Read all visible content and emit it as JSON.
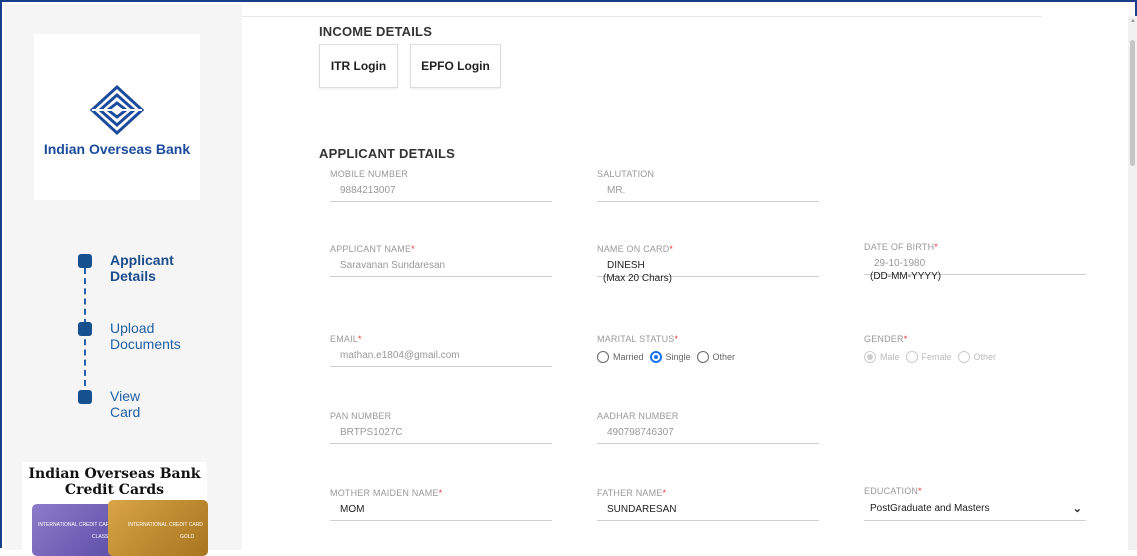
{
  "brand": {
    "name": "Indian Overseas Bank",
    "color": "#1c4a9c"
  },
  "steps": [
    {
      "label": "Applicant Details",
      "active": true
    },
    {
      "label": "Upload Documents",
      "active": false
    },
    {
      "label": "View Card",
      "active": false
    }
  ],
  "promo": {
    "title_line1": "Indian Overseas Bank",
    "title_line2": "Credit Cards",
    "card1_text": "INTERNATIONAL CREDIT CARD",
    "card2_text": "INTERNATIONAL CREDIT CARD",
    "card1_tier": "CLASSIC",
    "card2_tier": "GOLD"
  },
  "income": {
    "title": "INCOME DETAILS",
    "buttons": [
      "ITR Login",
      "EPFO Login"
    ]
  },
  "applicant": {
    "title": "APPLICANT DETAILS",
    "mobile": {
      "label": "MOBILE NUMBER",
      "value": "9884213007"
    },
    "salutation": {
      "label": "SALUTATION",
      "value": "MR."
    },
    "name": {
      "label": "APPLICANT NAME",
      "value": "Saravanan Sundaresan"
    },
    "name_on_card": {
      "label": "NAME ON CARD",
      "value": "DINESH",
      "hint": "(Max 20 Chars)"
    },
    "dob": {
      "label": "DATE OF BIRTH",
      "value": "29-10-1980",
      "hint": "(DD-MM-YYYY)"
    },
    "email": {
      "label": "EMAIL",
      "value": "mathan.e1804@gmail.com"
    },
    "marital": {
      "label": "MARITAL STATUS",
      "options": [
        "Married",
        "Single",
        "Other"
      ],
      "selected": "Single"
    },
    "gender": {
      "label": "GENDER",
      "options": [
        "Male",
        "Female",
        "Other"
      ],
      "selected": "Male"
    },
    "pan": {
      "label": "PAN NUMBER",
      "value": "BRTPS1027C"
    },
    "aadhar": {
      "label": "AADHAR NUMBER",
      "value": "490798746307"
    },
    "mother": {
      "label": "MOTHER MAIDEN NAME",
      "value": "MOM"
    },
    "father": {
      "label": "FATHER NAME",
      "value": "SUNDARESAN"
    },
    "education": {
      "label": "EDUCATION",
      "value": "PostGraduate and Masters"
    }
  },
  "required_mark": "*"
}
